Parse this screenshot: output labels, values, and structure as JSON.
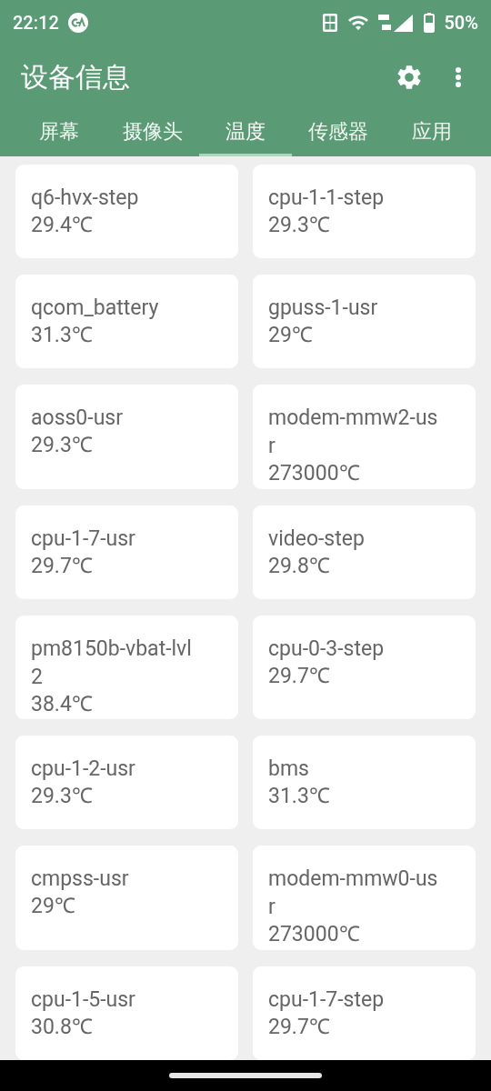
{
  "status_bar": {
    "time": "22:12",
    "battery": "50%"
  },
  "app_bar": {
    "title": "设备信息"
  },
  "tabs": [
    {
      "label": "屏幕",
      "selected": false
    },
    {
      "label": "摄像头",
      "selected": false
    },
    {
      "label": "温度",
      "selected": true
    },
    {
      "label": "传感器",
      "selected": false
    },
    {
      "label": "应用",
      "selected": false
    }
  ],
  "sensors": [
    {
      "name": "q6-hvx-step",
      "value": "29.4℃"
    },
    {
      "name": "cpu-1-1-step",
      "value": "29.3℃"
    },
    {
      "name": "qcom_battery",
      "value": "31.3℃"
    },
    {
      "name": "gpuss-1-usr",
      "value": "29℃"
    },
    {
      "name": "aoss0-usr",
      "value": "29.3℃"
    },
    {
      "name": "modem-mmw2-usr",
      "value": "273000℃"
    },
    {
      "name": "cpu-1-7-usr",
      "value": "29.7℃"
    },
    {
      "name": "video-step",
      "value": "29.8℃"
    },
    {
      "name": "pm8150b-vbat-lvl2",
      "value": "38.4℃"
    },
    {
      "name": "cpu-0-3-step",
      "value": "29.7℃"
    },
    {
      "name": "cpu-1-2-usr",
      "value": "29.3℃"
    },
    {
      "name": "bms",
      "value": "31.3℃"
    },
    {
      "name": "cmpss-usr",
      "value": "29℃"
    },
    {
      "name": "modem-mmw0-usr",
      "value": "273000℃"
    },
    {
      "name": "cpu-1-5-usr",
      "value": "30.8℃"
    },
    {
      "name": "cpu-1-7-step",
      "value": "29.7℃"
    }
  ]
}
